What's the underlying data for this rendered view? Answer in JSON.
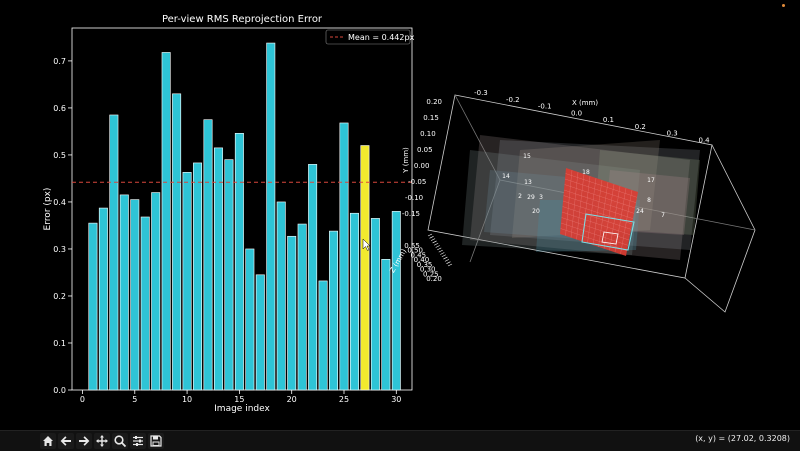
{
  "chart_data": [
    {
      "type": "bar",
      "title": "Per-view RMS Reprojection Error",
      "xlabel": "Image index",
      "ylabel": "Error (px)",
      "xlim": [
        -1,
        31.5
      ],
      "ylim": [
        0,
        0.77
      ],
      "xticks": [
        0,
        5,
        10,
        15,
        20,
        25,
        30
      ],
      "yticks": [
        0.0,
        0.1,
        0.2,
        0.3,
        0.4,
        0.5,
        0.6,
        0.7
      ],
      "x": [
        1,
        2,
        3,
        4,
        5,
        6,
        7,
        8,
        9,
        10,
        11,
        12,
        13,
        14,
        15,
        16,
        17,
        18,
        19,
        20,
        21,
        22,
        23,
        24,
        25,
        26,
        27,
        28,
        29,
        30
      ],
      "values": [
        0.355,
        0.387,
        0.585,
        0.415,
        0.405,
        0.368,
        0.42,
        0.718,
        0.63,
        0.463,
        0.483,
        0.575,
        0.515,
        0.49,
        0.546,
        0.3,
        0.245,
        0.738,
        0.4,
        0.327,
        0.353,
        0.48,
        0.232,
        0.338,
        0.568,
        0.376,
        0.52,
        0.365,
        0.278,
        0.38
      ],
      "highlight_index": 27,
      "bar_color": "#2ec4d6",
      "highlight_color": "#f2ea2e",
      "mean": 0.442,
      "mean_color": "#d9473c",
      "legend": {
        "label": "Mean = 0.442px",
        "placement": "top-right"
      }
    },
    {
      "type": "3d-views",
      "xlabel": "X (mm)",
      "ylabel": "Y (mm)",
      "zlabel": "Z (mm)",
      "xticks": [
        "-0.3",
        "-0.2",
        "-0.1",
        "0.0",
        "0.1",
        "0.2",
        "0.3",
        "0.4"
      ],
      "yticks": [
        "0.20",
        "0.15",
        "0.10",
        "0.05",
        "0.00",
        "-0.05",
        "-0.10",
        "-0.15"
      ],
      "zticks": [
        "0.55",
        "0.50",
        "0.45",
        "0.40",
        "0.35",
        "0.30",
        "0.25",
        "0.20"
      ],
      "view_labels": [
        "15",
        "14",
        "13",
        "18",
        "17",
        "2",
        "29",
        "3",
        "8",
        "20",
        "24",
        "7"
      ],
      "highlight_color": "#e03a30"
    }
  ],
  "toolbar": {
    "icons": [
      "home-icon",
      "back-icon",
      "forward-icon",
      "pan-icon",
      "zoom-icon",
      "configure-icon",
      "save-icon"
    ],
    "coords": "(x, y) = (27.02, 0.3208)"
  }
}
